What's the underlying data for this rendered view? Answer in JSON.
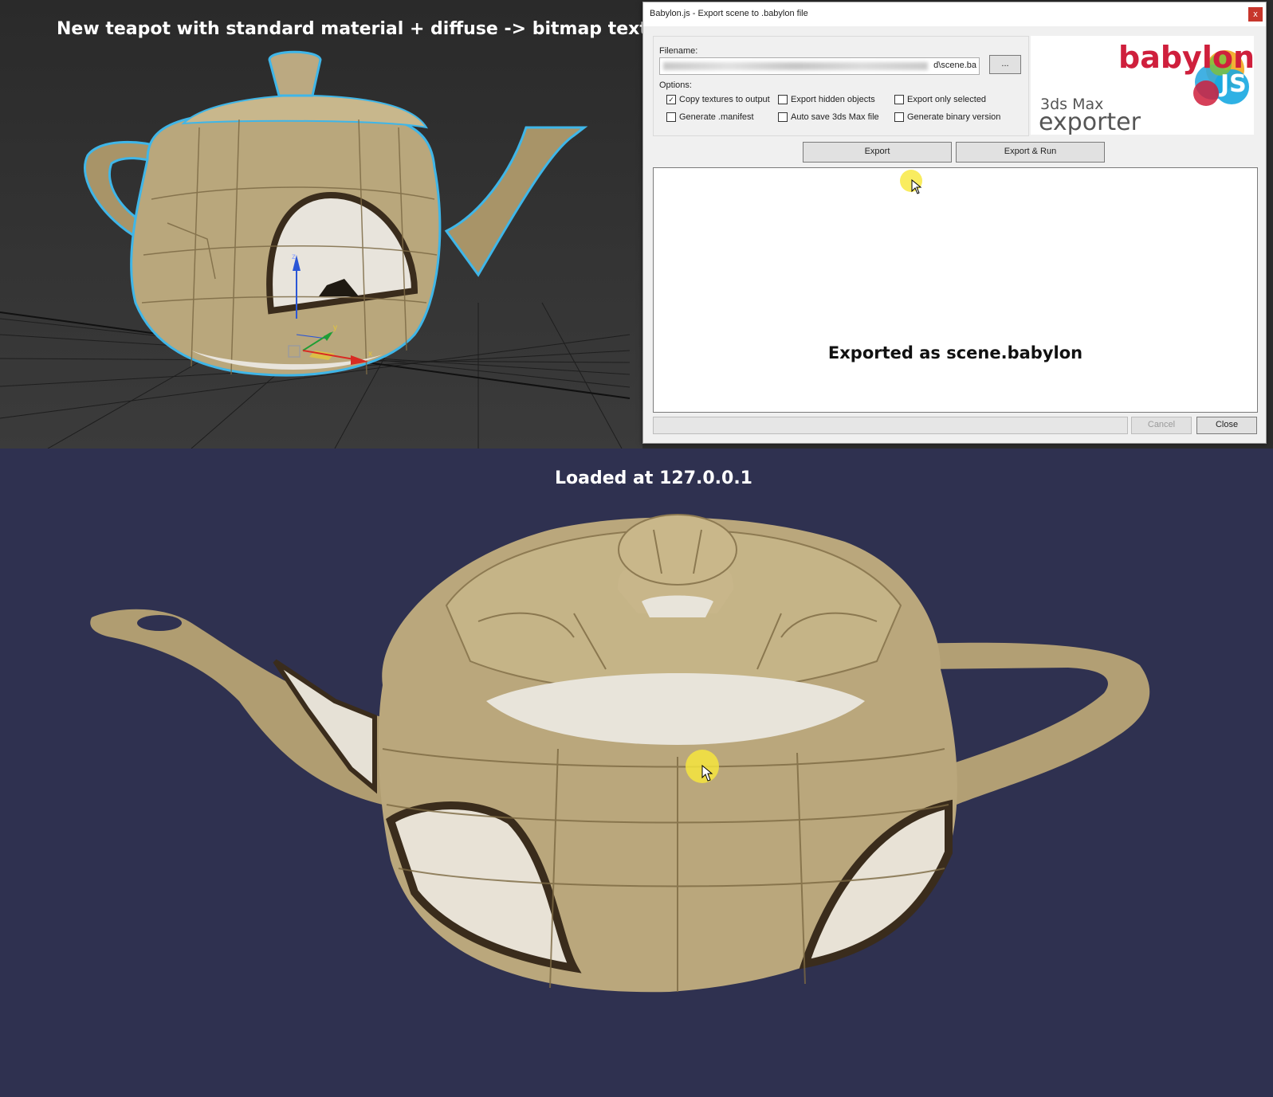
{
  "captions": {
    "top": "New teapot with standard material + diffuse -> bitmap texture",
    "bottom": "Loaded at 127.0.0.1"
  },
  "dialog": {
    "title": "Babylon.js - Export scene to .babylon file",
    "close_glyph": "x",
    "filename_label": "Filename:",
    "filename_value": "d\\scene.ba",
    "browse_label": "...",
    "options_label": "Options:",
    "options": [
      {
        "label": "Copy textures to output",
        "checked": true
      },
      {
        "label": "Export hidden objects",
        "checked": false
      },
      {
        "label": "Export only selected",
        "checked": false
      },
      {
        "label": "Generate .manifest",
        "checked": false
      },
      {
        "label": "Auto save 3ds Max file",
        "checked": false
      },
      {
        "label": "Generate binary version",
        "checked": false
      }
    ],
    "export_label": "Export",
    "export_run_label": "Export & Run",
    "log_message": "Exported as scene.babylon",
    "cancel_label": "Cancel",
    "close_label": "Close"
  },
  "logo": {
    "brand": "babylon",
    "brand_badge": "JS",
    "product_line1": "3ds Max",
    "product_line2": "exporter",
    "brand_color": "#cf1f3c"
  },
  "viewport": {
    "axis_labels": {
      "z": "z",
      "y": "y",
      "x": "x"
    }
  },
  "colors": {
    "viewport_bg": "#2d2d2d",
    "scene_bg": "#2f3150",
    "selection_outline": "#3fb6e8",
    "texture_base": "#b9a77c",
    "cursor_highlight": "#f8e83c"
  }
}
